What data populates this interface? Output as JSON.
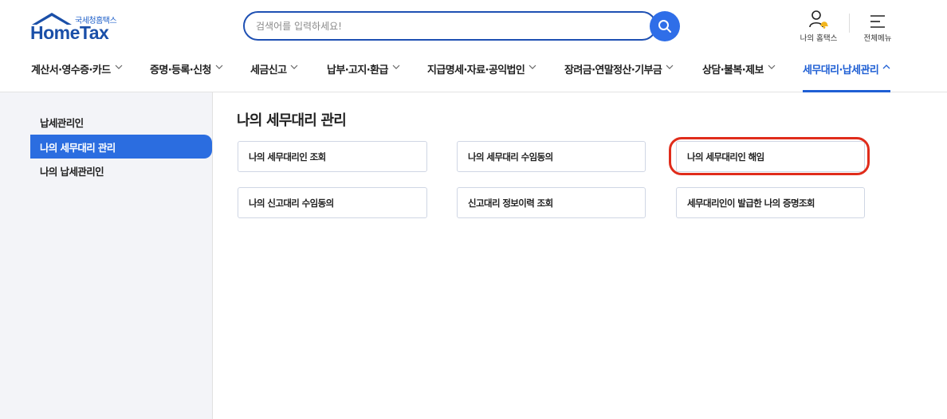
{
  "brand": {
    "subtitle": "국세청홈택스",
    "name": "HomeTax",
    "color": "#1a4fa8"
  },
  "search": {
    "placeholder": "검색어를 입력하세요!",
    "value": ""
  },
  "utility": {
    "my_hometax": {
      "label": "나의 홈택스",
      "icon": "user-bell-icon"
    },
    "all_menu": {
      "label": "전체메뉴",
      "icon": "hamburger-menu-icon"
    }
  },
  "gnb": {
    "items": [
      {
        "label": "계산서·영수증·카드"
      },
      {
        "label": "증명·등록·신청"
      },
      {
        "label": "세금신고"
      },
      {
        "label": "납부·고지·환급"
      },
      {
        "label": "지급명세·자료·공익법인"
      },
      {
        "label": "장려금·연말정산·기부금"
      },
      {
        "label": "상담·불복·제보"
      },
      {
        "label": "세무대리·납세관리"
      }
    ],
    "active_index": 7,
    "active_color": "#1f5fd4"
  },
  "sidebar": {
    "items": [
      {
        "label": "납세관리인"
      },
      {
        "label": "나의 세무대리 관리"
      },
      {
        "label": "나의 납세관리인"
      }
    ],
    "active_index": 1,
    "active_color": "#2b6de0"
  },
  "main": {
    "title": "나의 세무대리 관리",
    "cards": [
      {
        "label": "나의 세무대리인 조회"
      },
      {
        "label": "나의 세무대리 수임동의"
      },
      {
        "label": "나의 세무대리인 해임"
      },
      {
        "label": "나의 신고대리 수임동의"
      },
      {
        "label": "신고대리 정보이력 조회"
      },
      {
        "label": "세무대리인이 발급한 나의 증명조회"
      }
    ],
    "highlighted_index": 2,
    "highlight_color": "#e02c1b"
  }
}
